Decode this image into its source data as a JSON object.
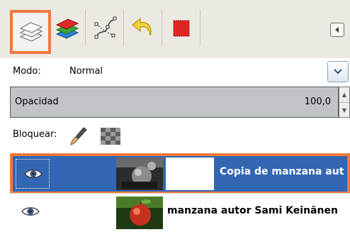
{
  "tabs": [
    {
      "name": "Capas",
      "icon": "layers-icon",
      "active": true
    },
    {
      "name": "Canales",
      "icon": "channels-icon",
      "active": false
    },
    {
      "name": "Rutas",
      "icon": "paths-icon",
      "active": false
    },
    {
      "name": "Deshacer",
      "icon": "undo-icon",
      "active": false
    },
    {
      "name": "Color",
      "icon": "red-square-icon",
      "active": false
    }
  ],
  "controls": {
    "mode_label": "Modo:",
    "mode_value": "Normal",
    "opacity_label": "Opacidad",
    "opacity_value": "100,0",
    "opacity_fraction": 1.0,
    "lock_label": "Bloquear:"
  },
  "layers": [
    {
      "name": "Copia de manzana autor Sami Keinänen",
      "visible": true,
      "selected": true
    },
    {
      "name": "manzana autor Sami Keinänen",
      "visible": true,
      "selected": false
    }
  ],
  "colors": {
    "accent": "#f07a3c",
    "selection": "#3366b3"
  }
}
